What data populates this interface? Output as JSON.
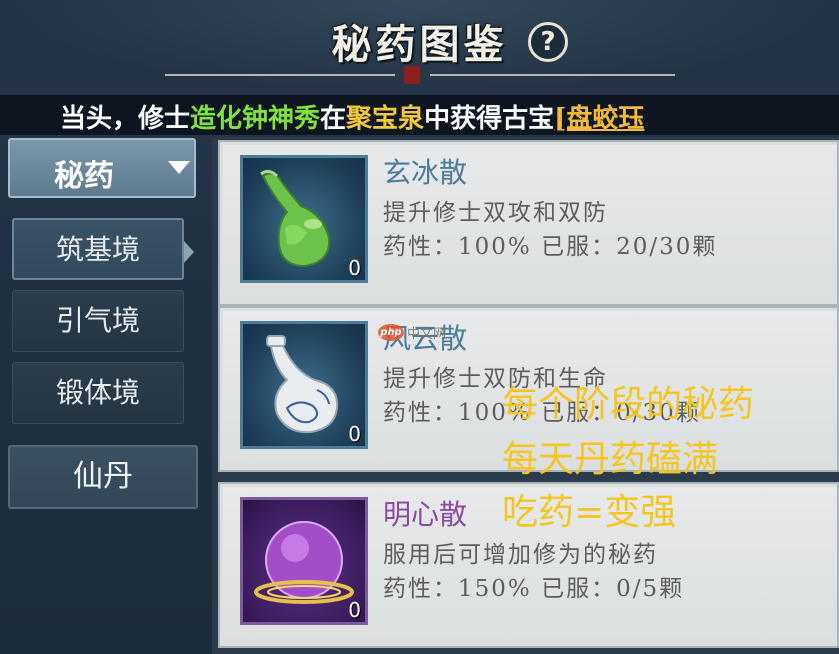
{
  "header": {
    "title": "秘药图鉴",
    "help_label": "?"
  },
  "ticker": {
    "prefix": "当头，修士",
    "player_name": "造化钟神秀",
    "mid1": "在",
    "location": "聚宝泉",
    "mid2": "中获得古宝",
    "item": "[盘蛟珏"
  },
  "nav": {
    "dropdown_label": "秘药",
    "items": [
      {
        "label": "筑基境",
        "active": true
      },
      {
        "label": "引气境",
        "active": false
      },
      {
        "label": "锻体境",
        "active": false
      }
    ],
    "secondary_label": "仙丹"
  },
  "medicines": [
    {
      "name": "玄冰散",
      "description": "提升修士双攻和双防",
      "potency_label": "药性：",
      "potency": "100%",
      "taken_label": "已服：",
      "taken": "20/30颗",
      "count": "0",
      "icon": "green-gourd-bottle-icon"
    },
    {
      "name": "风云散",
      "description": "提升修士双防和生命",
      "potency_label": "药性：",
      "potency": "100%",
      "taken_label": "已服：",
      "taken": "0/30颗",
      "count": "0",
      "icon": "white-porcelain-vase-icon"
    },
    {
      "name": "明心散",
      "description": "服用后可增加修为的秘药",
      "potency_label": "药性：",
      "potency": "150%",
      "taken_label": "已服：",
      "taken": "0/5颗",
      "count": "0",
      "icon": "purple-orb-icon"
    }
  ],
  "watermark": {
    "logo": "php",
    "text": "中文网"
  },
  "annotation": {
    "line1": "每个阶段的秘药",
    "line2": "每天丹药磕满",
    "line3": "吃药=变强"
  },
  "colors": {
    "accent_blue": "#4b7b9d",
    "accent_purple": "#8a4aa5",
    "annotation_yellow": "#f5c521",
    "ticker_green": "#7fe13b",
    "ticker_yellow": "#f4c93a"
  }
}
